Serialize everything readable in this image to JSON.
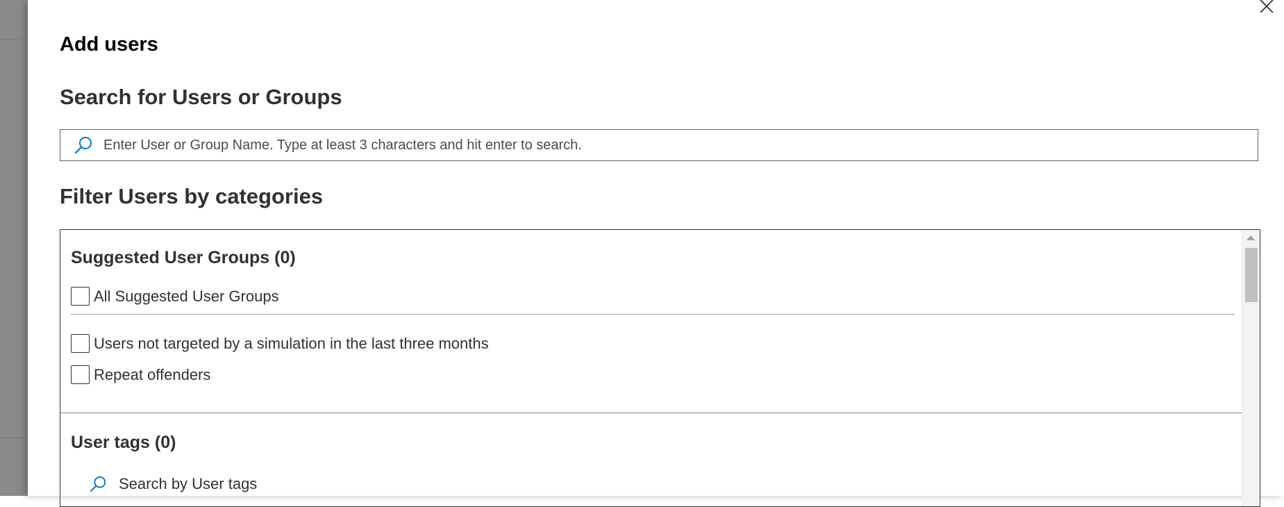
{
  "panel": {
    "title": "Add users",
    "close_label": "Close"
  },
  "search": {
    "title": "Search for Users or Groups",
    "placeholder": "Enter User or Group Name. Type at least 3 characters and hit enter to search.",
    "value": "",
    "icon": "search-icon"
  },
  "filter": {
    "title": "Filter Users by categories",
    "suggested": {
      "title": "Suggested User Groups (0)",
      "all_label": "All Suggested User Groups",
      "items": [
        {
          "label": "Users not targeted by a simulation in the last three months",
          "checked": false
        },
        {
          "label": "Repeat offenders",
          "checked": false
        }
      ]
    },
    "tags": {
      "title": "User tags (0)",
      "search_placeholder": "Search by User tags",
      "icon": "search-icon"
    }
  },
  "colors": {
    "accent": "#0078d4",
    "text": "#323130",
    "border": "#605e5c"
  }
}
